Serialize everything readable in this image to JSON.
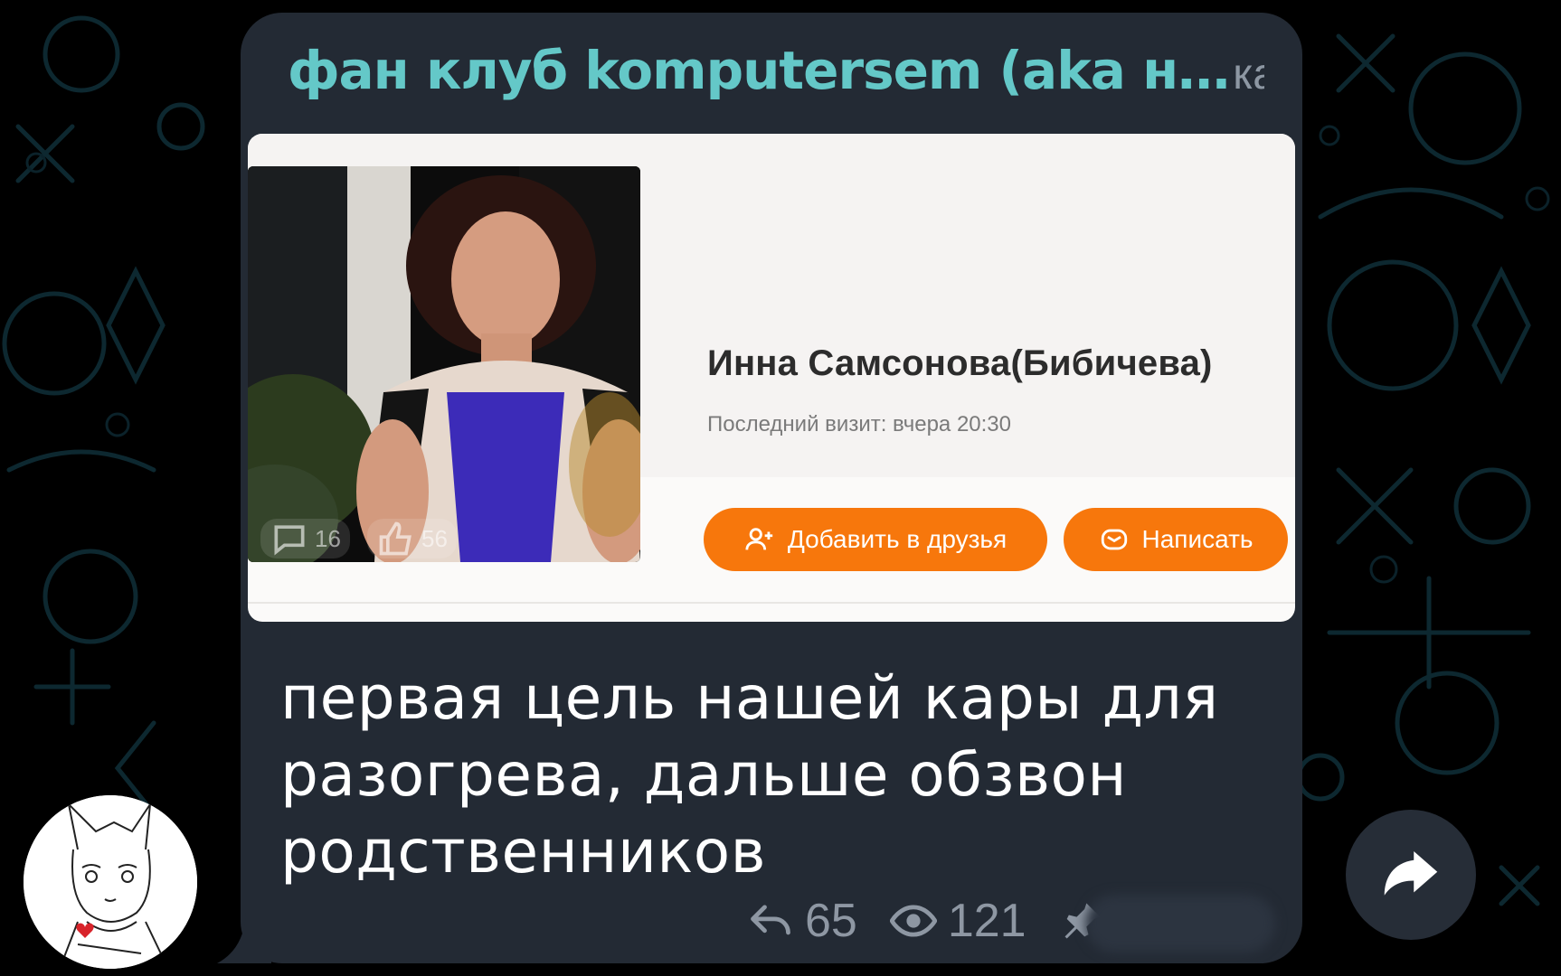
{
  "colors": {
    "bubble": "#232a34",
    "channel_name": "#64c8c8",
    "meta_text": "#8e97a3",
    "ok_orange": "#f7770c",
    "pattern": "#0f2a33"
  },
  "post": {
    "channel_name": "фан клуб komputersem (aka н…",
    "channel_type": "канал",
    "text_lines": [
      "первая цель нашей кары для",
      "разогрева, дальше обзвон",
      "родственников"
    ]
  },
  "embed": {
    "profile_name": "Инна Самсонова(Бибичева)",
    "last_visit": "Последний визит: вчера 20:30",
    "add_friend_label": "Добавить в друзья",
    "write_label": "Написать",
    "photo_comments": "16",
    "photo_likes": "56"
  },
  "meta": {
    "replies": "65",
    "views": "121",
    "icons": [
      "reply-icon",
      "eye-icon",
      "pin-icon"
    ]
  },
  "icons": {
    "share": "share-arrow-icon",
    "avatar": "channel-avatar"
  }
}
